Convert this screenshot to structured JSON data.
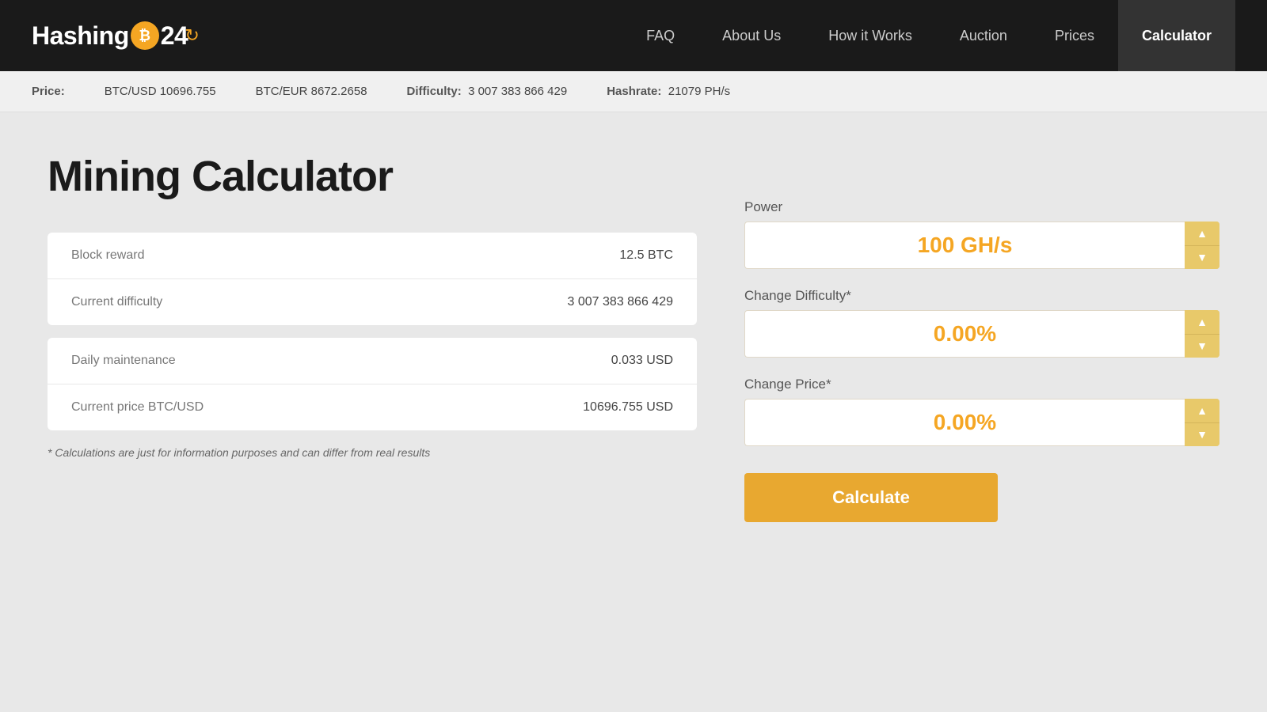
{
  "header": {
    "logo_text_1": "Hashing",
    "logo_text_2": "24",
    "nav_items": [
      {
        "label": "FAQ",
        "id": "faq",
        "active": false
      },
      {
        "label": "About Us",
        "id": "about",
        "active": false
      },
      {
        "label": "How it Works",
        "id": "how-it-works",
        "active": false
      },
      {
        "label": "Auction",
        "id": "auction",
        "active": false
      },
      {
        "label": "Prices",
        "id": "prices",
        "active": false
      },
      {
        "label": "Calculator",
        "id": "calculator",
        "active": true
      }
    ]
  },
  "ticker": {
    "price_label": "Price:",
    "btc_usd": "BTC/USD 10696.755",
    "btc_eur": "BTC/EUR 8672.2658",
    "difficulty_label": "Difficulty:",
    "difficulty_value": "3 007 383 866 429",
    "hashrate_label": "Hashrate:",
    "hashrate_value": "21079 PH/s"
  },
  "main": {
    "page_title": "Mining Calculator",
    "info_cards": [
      {
        "rows": [
          {
            "label": "Block reward",
            "value": "12.5 BTC"
          },
          {
            "label": "Current difficulty",
            "value": "3 007 383 866 429"
          }
        ]
      },
      {
        "rows": [
          {
            "label": "Daily maintenance",
            "value": "0.033 USD"
          },
          {
            "label": "Current price BTC/USD",
            "value": "10696.755 USD"
          }
        ]
      }
    ],
    "footnote": "* Calculations are just for information purposes and can differ from real results",
    "calculator": {
      "power_label": "Power",
      "power_value": "100 GH/s",
      "difficulty_label": "Change Difficulty*",
      "difficulty_value": "0.00%",
      "price_label": "Change Price*",
      "price_value": "0.00%",
      "calculate_label": "Calculate"
    }
  }
}
